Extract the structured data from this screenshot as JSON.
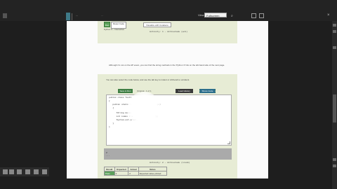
{
  "topbar": {
    "breadcrumb": "...",
    "crumb_secondary": "...",
    "view_label": "View",
    "view_select": "Fullscreen",
    "close": "×"
  },
  "section1": {
    "btn_run": "Run",
    "btn_reset": "Reset Code",
    "btn_visualize": "Visualize with Codelens",
    "code_line": "Python 3 – Interactive",
    "status": "Activity: 1 – ActiveCode (ac1)"
  },
  "paragraph": "Although it's not on the AP exam, you can find the string methods in the 'Python 3' link on the left-hand side of the next page.",
  "note_line": "You can also select the code below, and use the tab key to indent or shift+tab to unindent.",
  "section2": {
    "btn_save": "Save & Run",
    "version_label": "Original - 1 of 1",
    "btn_load": "Load History",
    "btn_codelens": "Show CodeLens",
    "btn_share": "Share Code",
    "code_lines": [
      "public class Test1",
      "{",
      "   public static void main(String[] args)",
      "   {",
      "      String message = \"Hello\";",
      "      int index = message.indexOf(\"l\");",
      "      System.out.println(index);",
      "   }",
      "}"
    ],
    "output_lines": [
      "2",
      "..."
    ],
    "table_headers": [
      "Result",
      "Expected",
      "Actual",
      "Notes"
    ],
    "table_row": [
      "Pass",
      "2",
      "2",
      "Expected value printed"
    ],
    "status": "Activity: 2 – ActiveCode (lcsm1)"
  }
}
